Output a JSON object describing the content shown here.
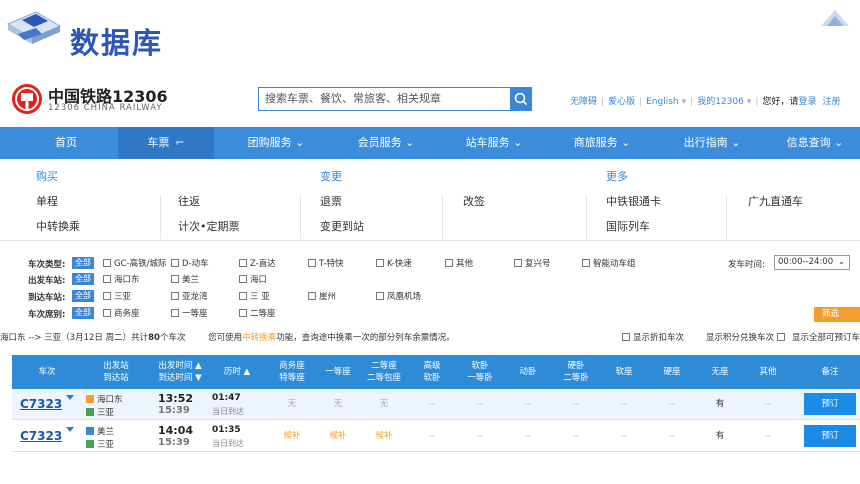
{
  "slide": {
    "title": "数据库"
  },
  "logo": {
    "cn": "中国铁路12306",
    "en": "12306 CHINA RAILWAY"
  },
  "search": {
    "placeholder": "搜索车票、餐饮、常旅客、相关规章"
  },
  "topnav": {
    "items": [
      "无障碍",
      "爱心版",
      "English",
      "我的12306"
    ],
    "greeting": "您好，请",
    "login": "登录",
    "register": "注册"
  },
  "mainnav": {
    "items": [
      "首页",
      "车票",
      "团购服务",
      "会员服务",
      "站车服务",
      "商旅服务",
      "出行指南",
      "信息查询"
    ]
  },
  "dropdown": {
    "groups": [
      {
        "title": "购买",
        "items": [
          "单程",
          "往返",
          "中转换乘",
          "计次•定期票"
        ]
      },
      {
        "title": "变更",
        "items": [
          "退票",
          "改签",
          "变更到站"
        ]
      },
      {
        "title": "更多",
        "items": [
          "中铁银通卡",
          "广九直通车",
          "国际列车"
        ]
      }
    ]
  },
  "filters": {
    "all_label": "全部",
    "train_type": {
      "label": "车次类型:",
      "options": [
        "GC-高铁/城际",
        "D-动车",
        "Z-直达",
        "T-特快",
        "K-快速",
        "其他",
        "复兴号",
        "智能动车组"
      ]
    },
    "from_station": {
      "label": "出发车站:",
      "options": [
        "海口东",
        "美兰",
        "海口"
      ]
    },
    "to_station": {
      "label": "到达车站:",
      "options": [
        "三亚",
        "亚龙湾",
        "三 亚",
        "崖州",
        "凤凰机场"
      ]
    },
    "seat_type": {
      "label": "车次席别:",
      "options": [
        "商务座",
        "一等座",
        "二等座"
      ]
    },
    "depart_time_label": "发车时间:",
    "depart_time_value": "00:00--24:00",
    "filter_button": "筛选"
  },
  "summary": {
    "route": "海口东 --> 三亚（3月12日  周二）共计",
    "count": "80",
    "count_suffix": "个车次",
    "hint_prefix": "您可使用",
    "hint_link": "中转换乘",
    "hint_suffix": "功能，查询途中换乘一次的部分列车余票情况。",
    "options": [
      "显示折扣车次",
      "显示积分兑换车次",
      "显示全部可预订车"
    ]
  },
  "table": {
    "headers": [
      {
        "l1": "车次",
        "l2": ""
      },
      {
        "l1": "出发站",
        "l2": "到达站"
      },
      {
        "l1": "出发时间 ▲",
        "l2": "到达时间 ▼"
      },
      {
        "l1": "历时 ▲",
        "l2": ""
      },
      {
        "l1": "商务座",
        "l2": "特等座"
      },
      {
        "l1": "一等座",
        "l2": ""
      },
      {
        "l1": "二等座",
        "l2": "二等包座"
      },
      {
        "l1": "高级",
        "l2": "软卧"
      },
      {
        "l1": "软卧",
        "l2": "一等卧"
      },
      {
        "l1": "动卧",
        "l2": ""
      },
      {
        "l1": "硬卧",
        "l2": "二等卧"
      },
      {
        "l1": "软座",
        "l2": ""
      },
      {
        "l1": "硬座",
        "l2": ""
      },
      {
        "l1": "无座",
        "l2": ""
      },
      {
        "l1": "其他",
        "l2": ""
      },
      {
        "l1": "备注",
        "l2": ""
      }
    ],
    "rows": [
      {
        "train": "C7323",
        "from": "海口东",
        "from_badge": "始",
        "to": "三亚",
        "to_badge": "终",
        "depart": "13:52",
        "arrive": "15:39",
        "duration": "01:47",
        "arrival_day": "当日到达",
        "cells": [
          "无",
          "无",
          "无",
          "--",
          "--",
          "--",
          "--",
          "--",
          "--",
          "有",
          "--"
        ],
        "book": "预订"
      },
      {
        "train": "C7323",
        "from": "美兰",
        "from_badge": "过",
        "to": "三亚",
        "to_badge": "终",
        "depart": "14:04",
        "arrive": "15:39",
        "duration": "01:35",
        "arrival_day": "当日到达",
        "cells": [
          "候补",
          "候补",
          "候补",
          "--",
          "--",
          "--",
          "--",
          "--",
          "--",
          "有",
          "--"
        ],
        "book": "预订"
      }
    ]
  },
  "colors": {
    "accent": "#3b8ddb",
    "title": "#2d56b8",
    "orange": "#f49d2c",
    "brand_red": "#e0231c"
  }
}
